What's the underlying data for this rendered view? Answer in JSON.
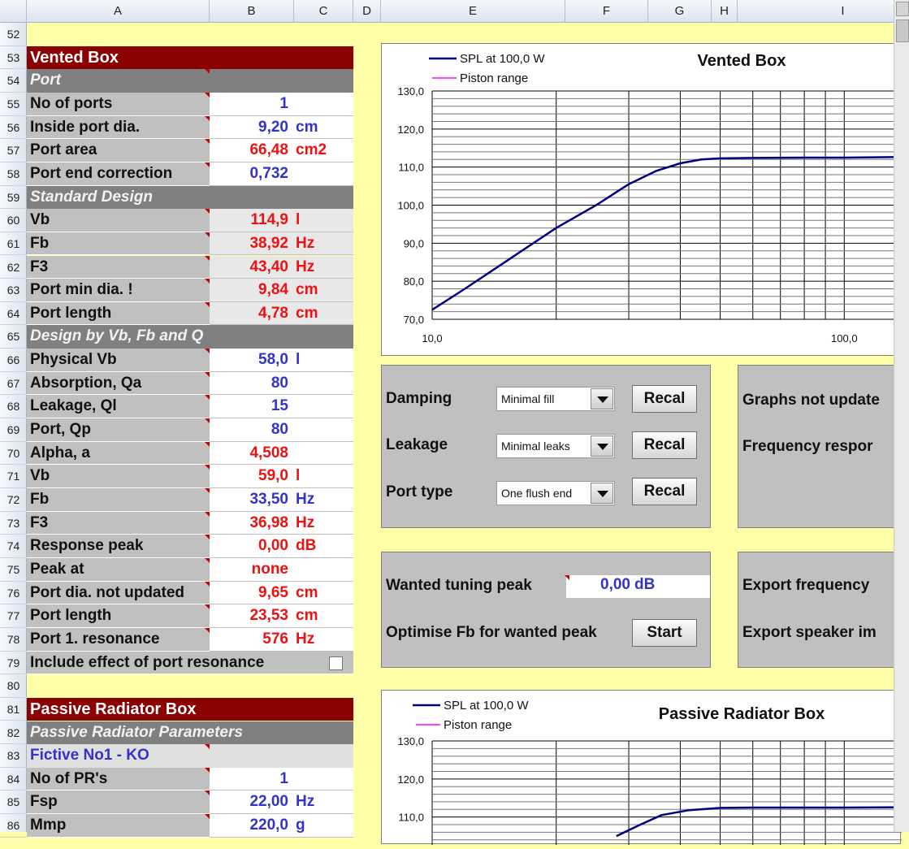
{
  "columns": [
    "A",
    "B",
    "C",
    "D",
    "E",
    "F",
    "G",
    "H",
    "I"
  ],
  "rows": [
    "52",
    "53",
    "54",
    "55",
    "56",
    "57",
    "58",
    "59",
    "60",
    "61",
    "62",
    "63",
    "64",
    "65",
    "66",
    "67",
    "68",
    "69",
    "70",
    "71",
    "72",
    "73",
    "74",
    "75",
    "76",
    "77",
    "78",
    "79",
    "80",
    "81",
    "82",
    "83",
    "84",
    "85",
    "86"
  ],
  "vented": {
    "title": "Vented Box",
    "port_header": "Port",
    "rows_port": [
      {
        "label": "No of ports",
        "value": "1",
        "unit": "",
        "color": "blue"
      },
      {
        "label": "Inside port dia.",
        "value": "9,20",
        "unit": "cm",
        "color": "blue"
      },
      {
        "label": "Port area",
        "value": "66,48",
        "unit": "cm2",
        "color": "red"
      },
      {
        "label": "Port end correction",
        "value": "0,732",
        "unit": "",
        "color": "blue"
      }
    ],
    "std_header": "Standard Design",
    "rows_std": [
      {
        "label": "Vb",
        "value": "114,9",
        "unit": "l",
        "color": "red"
      },
      {
        "label": "Fb",
        "value": "38,92",
        "unit": "Hz",
        "color": "red"
      },
      {
        "label": "F3",
        "value": "43,40",
        "unit": "Hz",
        "color": "red"
      },
      {
        "label": "Port min dia. !",
        "value": "9,84",
        "unit": "cm",
        "color": "red"
      },
      {
        "label": "Port length",
        "value": "4,78",
        "unit": "cm",
        "color": "red"
      }
    ],
    "vbq_header": "Design by Vb, Fb and Q",
    "rows_vbq": [
      {
        "label": "Physical Vb",
        "value": "58,0",
        "unit": "l",
        "color": "blue"
      },
      {
        "label": "Absorption, Qa",
        "value": "80",
        "unit": "",
        "color": "blue"
      },
      {
        "label": "Leakage, Ql",
        "value": "15",
        "unit": "",
        "color": "blue"
      },
      {
        "label": "Port, Qp",
        "value": "80",
        "unit": "",
        "color": "blue"
      },
      {
        "label": "Alpha, a",
        "value": "4,508",
        "unit": "",
        "color": "red"
      },
      {
        "label": "Vb",
        "value": "59,0",
        "unit": "l",
        "color": "red"
      },
      {
        "label": "Fb",
        "value": "33,50",
        "unit": "Hz",
        "color": "blue"
      },
      {
        "label": "F3",
        "value": "36,98",
        "unit": "Hz",
        "color": "red"
      },
      {
        "label": "Response peak",
        "value": "0,00",
        "unit": "dB",
        "color": "red"
      },
      {
        "label": "Peak at",
        "value": "none",
        "unit": "",
        "color": "red"
      },
      {
        "label": "Port dia. not updated",
        "value": "9,65",
        "unit": "cm",
        "color": "red"
      },
      {
        "label": "Port length",
        "value": "23,53",
        "unit": "cm",
        "color": "red"
      },
      {
        "label": "Port 1. resonance",
        "value": "576",
        "unit": "Hz",
        "color": "red"
      }
    ],
    "include_port_resonance": "Include effect of port resonance"
  },
  "passive": {
    "title": "Passive Radiator Box",
    "params_header": "Passive Radiator Parameters",
    "model": "Fictive No1 - KO",
    "rows": [
      {
        "label": "No of PR's",
        "value": "1",
        "unit": "",
        "color": "blue"
      },
      {
        "label": "Fsp",
        "value": "22,00",
        "unit": "Hz",
        "color": "blue"
      },
      {
        "label": "Mmp",
        "value": "220,0",
        "unit": "g",
        "color": "blue"
      }
    ]
  },
  "controls": {
    "damping_label": "Damping",
    "damping_value": "Minimal fill",
    "leakage_label": "Leakage",
    "leakage_value": "Minimal leaks",
    "porttype_label": "Port type",
    "porttype_value": "One flush end",
    "recal": "Recal",
    "graphs_not_updated": "Graphs not update",
    "frequency_response": "Frequency respor",
    "wanted_peak_label": "Wanted tuning peak",
    "wanted_peak_value": "0,00",
    "wanted_peak_unit": "dB",
    "optimise_label": "Optimise Fb for wanted peak",
    "start": "Start",
    "export_frequency": "Export frequency",
    "export_speaker": "Export speaker im"
  },
  "chart_data": [
    {
      "type": "line",
      "title": "Vented Box",
      "legend": [
        "SPL at 100,0 W",
        "Piston range"
      ],
      "legend_placement": "top-left",
      "x_scale": "log",
      "xlim": [
        10,
        200
      ],
      "ylim": [
        70,
        130
      ],
      "y_ticks": [
        "130,0",
        "120,0",
        "110,0",
        "100,0",
        "90,0",
        "80,0",
        "70,0"
      ],
      "x_ticks": [
        "10,0",
        "100,0"
      ],
      "series": [
        {
          "name": "SPL at 100,0 W",
          "color": "#000080",
          "x": [
            10,
            12,
            15,
            20,
            25,
            30,
            35,
            40,
            45,
            50,
            60,
            80,
            100,
            150,
            200
          ],
          "y": [
            72.5,
            78,
            85,
            94,
            100,
            105.5,
            109,
            111,
            112,
            112.3,
            112.4,
            112.5,
            112.5,
            112.7,
            112.8
          ]
        }
      ]
    },
    {
      "type": "line",
      "title": "Passive Radiator Box",
      "legend": [
        "SPL at 100,0 W",
        "Piston range"
      ],
      "legend_placement": "top-left",
      "x_scale": "log",
      "xlim": [
        10,
        200
      ],
      "ylim": [
        70,
        130
      ],
      "y_ticks": [
        "130,0",
        "120,0",
        "110,0"
      ],
      "series": [
        {
          "name": "SPL at 100,0 W",
          "color": "#000080",
          "x": [
            28,
            32,
            36,
            42,
            50,
            60,
            80,
            100,
            150,
            200
          ],
          "y": [
            105,
            108,
            110.5,
            111.8,
            112.4,
            112.5,
            112.5,
            112.5,
            112.6,
            112.7
          ]
        }
      ]
    }
  ]
}
